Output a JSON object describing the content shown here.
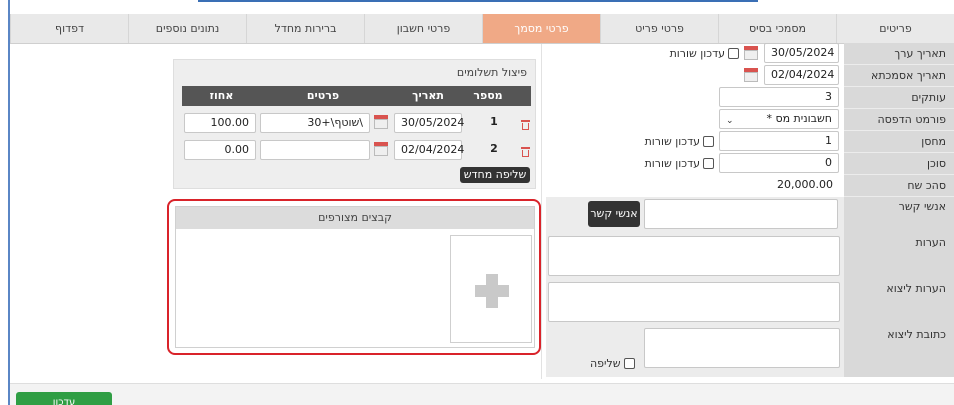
{
  "tabs": [
    "פריטים",
    "מסמכי בסיס",
    "פרטי פריט",
    "פרטי מסמך",
    "פרטי חשבון",
    "ברירות מחדל",
    "נתונים נוספים",
    "דפדוף"
  ],
  "active_tab_index": 3,
  "form": {
    "value_date_label": "תאריך ערך",
    "value_date": "30/05/2024",
    "reference_date_label": "תאריך אסמכתא",
    "reference_date": "02/04/2024",
    "copies_label": "עותקים",
    "copies": "3",
    "print_format_label": "פורמט הדפסה",
    "print_format": "* חשבונית מס",
    "warehouse_label": "מחסן",
    "warehouse": "1",
    "agent_label": "סוכן",
    "agent": "0",
    "total_label": "סהכ שח",
    "total": "20,000.00",
    "contacts_label": "אנשי קשר",
    "contacts_button": "אנשי קשר",
    "notes_label": "הערות",
    "export_notes_label": "הערות ליצוא",
    "export_address_label": "כתובת ליצוא",
    "update_lines_label": "עדכון שורות",
    "retrieve_label": "שליפה"
  },
  "payments": {
    "title": "פיצול תשלומים",
    "headers": [
      "מספר",
      "תאריך",
      "פרטים",
      "אחוז"
    ],
    "rows": [
      {
        "number": "1",
        "date": "30/05/2024",
        "details": "שוטף\\+30\\",
        "percent": "100.00"
      },
      {
        "number": "2",
        "date": "02/04/2024",
        "details": "",
        "percent": "0.00"
      }
    ],
    "refetch_button": "שליפה מחדש"
  },
  "files": {
    "title": "קבצים מצורפים"
  },
  "bottom": {
    "update_button": "עדכון"
  },
  "colors": {
    "active_tab": "#f0a986",
    "highlight_outline": "#d9232a",
    "save_green": "#2f9e44",
    "calendar_red": "#d9534f"
  }
}
